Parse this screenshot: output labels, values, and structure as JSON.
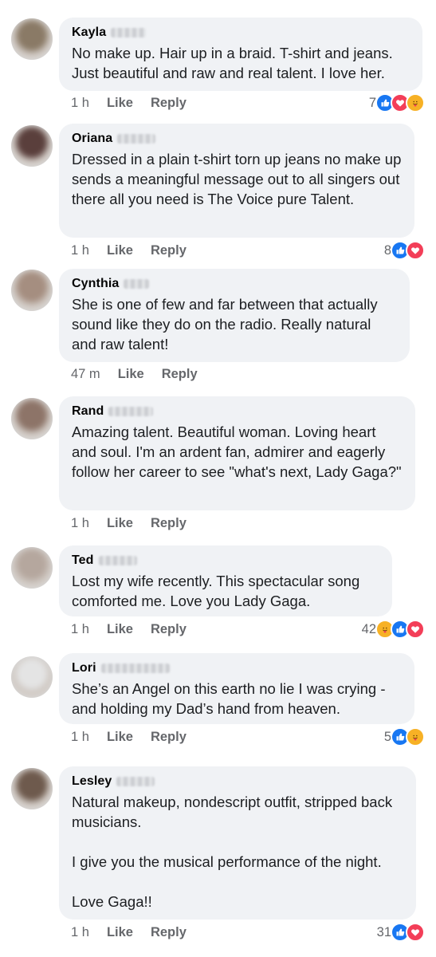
{
  "colors": {
    "bubble": "#f0f2f5",
    "secondary_text": "#65676b",
    "like_blue": "#1877f2",
    "love_red": "#f33e58",
    "care_yellow": "#f7b125"
  },
  "comments": [
    {
      "author": "Kayla",
      "text": "No make up. Hair up in a braid. T-shirt and jeans. Just beautiful and raw and real talent. I love her.",
      "time": "1 h",
      "like_label": "Like",
      "reply_label": "Reply",
      "reaction_count": "7",
      "reactions": [
        "like-icon",
        "love-icon",
        "care-icon"
      ],
      "avatar_color": "#8a7a66"
    },
    {
      "author": "Oriana",
      "text": "Dressed in a plain t-shirt torn up jeans no make up sends a meaningful message out to all singers out there all you need is The Voice pure Talent.",
      "time": "1 h",
      "like_label": "Like",
      "reply_label": "Reply",
      "reaction_count": "8",
      "reactions": [
        "like-icon",
        "love-icon"
      ],
      "avatar_color": "#5a3f3c"
    },
    {
      "author": "Cynthia",
      "text": "She is one of few and far between that actually sound like they do on the radio. Really natural and raw talent!",
      "time": "47 m",
      "like_label": "Like",
      "reply_label": "Reply",
      "reaction_count": "",
      "reactions": [],
      "avatar_color": "#a58e80"
    },
    {
      "author": "Rand",
      "text": "Amazing talent. Beautiful woman. Loving heart and soul. I'm an ardent fan, admirer and eagerly follow her career to see \"what's next, Lady Gaga?\"",
      "time": "1 h",
      "like_label": "Like",
      "reply_label": "Reply",
      "reaction_count": "",
      "reactions": [],
      "avatar_color": "#8d7468"
    },
    {
      "author": "Ted",
      "text": "Lost my wife recently. This spectacular song comforted me. Love you Lady Gaga.",
      "time": "1 h",
      "like_label": "Like",
      "reply_label": "Reply",
      "reaction_count": "42",
      "reactions": [
        "care-icon",
        "like-icon",
        "love-icon"
      ],
      "avatar_color": "#b5a79e"
    },
    {
      "author": "Lori",
      "text": "She’s an Angel on this earth no lie I was crying - and holding my Dad’s hand from heaven.",
      "time": "1 h",
      "like_label": "Like",
      "reply_label": "Reply",
      "reaction_count": "5",
      "reactions": [
        "like-icon",
        "care-icon"
      ],
      "avatar_color": "#e4e4e4"
    },
    {
      "author": "Lesley",
      "text": "Natural makeup, nondescript outfit, stripped back musicians.\n\nI give you the musical performance of the night.\n\nLove Gaga!!",
      "time": "1 h",
      "like_label": "Like",
      "reply_label": "Reply",
      "reaction_count": "31",
      "reactions": [
        "like-icon",
        "love-icon"
      ],
      "avatar_color": "#6e5a4d"
    }
  ]
}
